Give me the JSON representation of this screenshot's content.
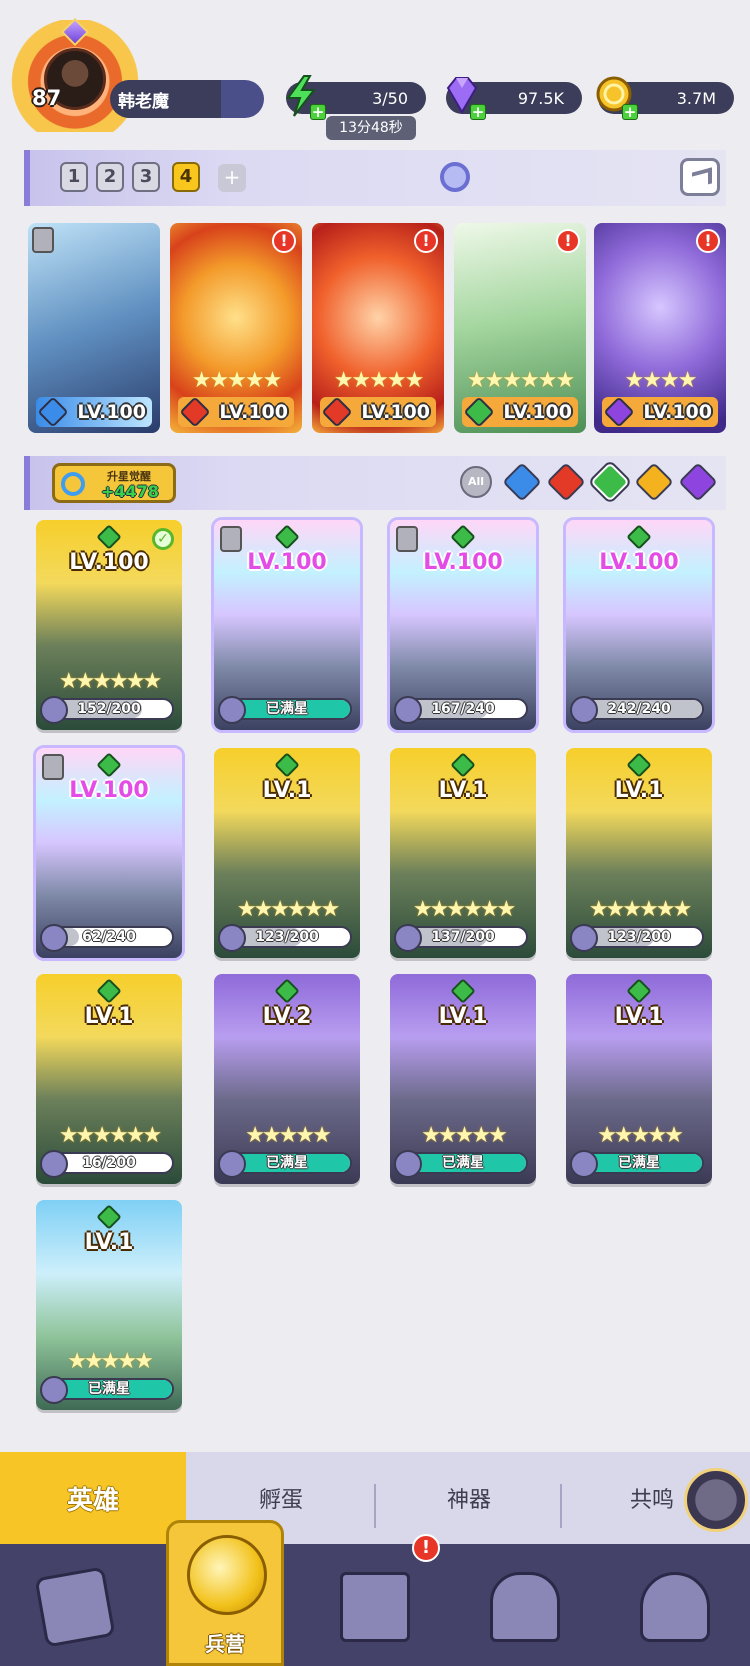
{
  "player": {
    "level": "87",
    "name": "韩老魔"
  },
  "resources": {
    "energy": "3/50",
    "energy_timer": "13分48秒",
    "gems": "97.5K",
    "gold": "3.7M"
  },
  "team_tabs": [
    "1",
    "2",
    "3",
    "4"
  ],
  "active_team": "4",
  "team_slots": [
    {
      "level": "LV.100",
      "element": "water",
      "stars": "",
      "alert": false
    },
    {
      "level": "LV.100",
      "element": "fire",
      "stars": "★★★★★",
      "alert": true
    },
    {
      "level": "LV.100",
      "element": "fire",
      "stars": "★★★★★",
      "alert": true
    },
    {
      "level": "LV.100",
      "element": "wind",
      "stars": "★★★★★★",
      "alert": true
    },
    {
      "level": "LV.100",
      "element": "dark",
      "stars": "★★★★",
      "alert": true
    }
  ],
  "alert_mark": "!",
  "star_awaken": {
    "title": "升星觉醒",
    "value": "+4478"
  },
  "filters": {
    "all_label": "All",
    "elements": [
      "water",
      "fire",
      "wind",
      "light",
      "dark"
    ]
  },
  "colors": {
    "water": "#3a8ce8",
    "fire": "#e23a26",
    "wind": "#3dbb48",
    "light": "#f3b21e",
    "dark": "#8e45e0",
    "accent_yellow": "#f7c525",
    "nav_bg": "#45426a"
  },
  "heroes": [
    {
      "level": "LV.100",
      "stars": "★★★★★★",
      "progress": "152/200",
      "progress_value": 0.76,
      "full": false,
      "frame": "gold",
      "checked": true,
      "shield": false
    },
    {
      "level": "LV.100",
      "stars": "",
      "progress": "已满星",
      "progress_value": 1.0,
      "full": true,
      "frame": "rainbow",
      "checked": false,
      "shield": true
    },
    {
      "level": "LV.100",
      "stars": "",
      "progress": "167/240",
      "progress_value": 0.7,
      "full": false,
      "frame": "rainbow",
      "checked": false,
      "shield": true
    },
    {
      "level": "LV.100",
      "stars": "",
      "progress": "242/240",
      "progress_value": 1.0,
      "full": false,
      "frame": "rainbow",
      "checked": false,
      "shield": false
    },
    {
      "level": "LV.100",
      "stars": "",
      "progress": "62/240",
      "progress_value": 0.26,
      "full": false,
      "frame": "rainbow",
      "checked": false,
      "shield": true
    },
    {
      "level": "LV.1",
      "stars": "★★★★★★",
      "progress": "123/200",
      "progress_value": 0.62,
      "full": false,
      "frame": "gold",
      "checked": false,
      "shield": false
    },
    {
      "level": "LV.1",
      "stars": "★★★★★★",
      "progress": "137/200",
      "progress_value": 0.69,
      "full": false,
      "frame": "gold",
      "checked": false,
      "shield": false
    },
    {
      "level": "LV.1",
      "stars": "★★★★★★",
      "progress": "123/200",
      "progress_value": 0.62,
      "full": false,
      "frame": "gold",
      "checked": false,
      "shield": false
    },
    {
      "level": "LV.1",
      "stars": "★★★★★★",
      "progress": "16/200",
      "progress_value": 0.08,
      "full": false,
      "frame": "gold",
      "checked": false,
      "shield": false
    },
    {
      "level": "LV.2",
      "stars": "★★★★★",
      "progress": "已满星",
      "progress_value": 1.0,
      "full": true,
      "frame": "purple",
      "checked": false,
      "shield": false
    },
    {
      "level": "LV.1",
      "stars": "★★★★★",
      "progress": "已满星",
      "progress_value": 1.0,
      "full": true,
      "frame": "purple",
      "checked": false,
      "shield": false
    },
    {
      "level": "LV.1",
      "stars": "★★★★★",
      "progress": "已满星",
      "progress_value": 1.0,
      "full": true,
      "frame": "purple",
      "checked": false,
      "shield": false
    },
    {
      "level": "LV.1",
      "stars": "★★★★★",
      "progress": "已满星",
      "progress_value": 1.0,
      "full": true,
      "frame": "blue",
      "checked": false,
      "shield": false
    }
  ],
  "sub_tabs": [
    "英雄",
    "孵蛋",
    "神器",
    "共鸣"
  ],
  "nav": {
    "active_label": "兵营",
    "alert": "!"
  }
}
